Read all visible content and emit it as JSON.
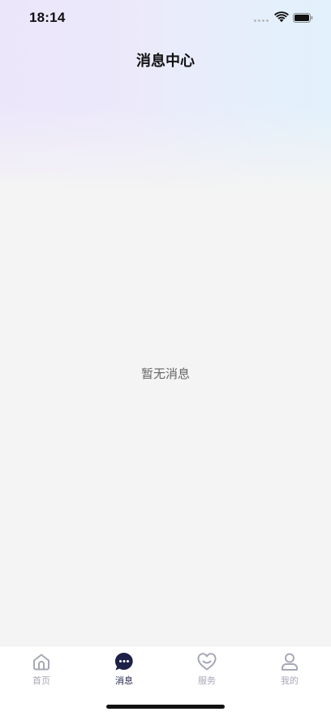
{
  "status_bar": {
    "time": "18:14",
    "icons": [
      "signal-icon",
      "wifi-icon",
      "battery-icon"
    ]
  },
  "header": {
    "title": "消息中心"
  },
  "main": {
    "empty_text": "暂无消息"
  },
  "tab_bar": {
    "active_index": 1,
    "items": [
      {
        "label": "首页",
        "icon": "home-icon"
      },
      {
        "label": "消息",
        "icon": "chat-bubble-icon"
      },
      {
        "label": "服务",
        "icon": "heart-smile-icon"
      },
      {
        "label": "我的",
        "icon": "user-icon"
      }
    ]
  },
  "colors": {
    "active_tab": "#1e2147",
    "inactive_tab": "#a6a8b6",
    "background": "#f4f4f4",
    "gradient_left": "#ece6fb",
    "gradient_right": "#e2f1fb"
  }
}
